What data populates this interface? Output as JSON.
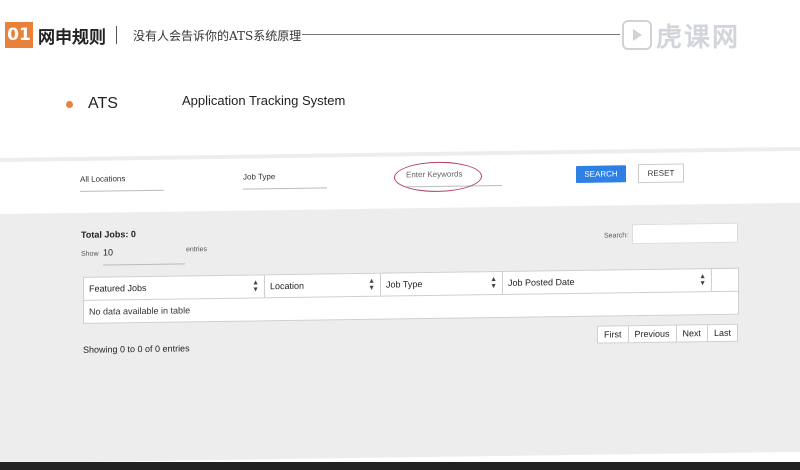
{
  "header": {
    "section_number": "01",
    "section_title": "网申规则",
    "separator": "|",
    "subtitle": "没有人会告诉你的ATS系统原理",
    "watermark_text": "虎课网",
    "accent_color": "#e8823a"
  },
  "bullet": {
    "term": "ATS",
    "description": "Application Tracking System"
  },
  "screenshot": {
    "filters": {
      "location": "All Locations",
      "job_type": "Job Type",
      "keywords_placeholder": "Enter Keywords"
    },
    "buttons": {
      "search": "SEARCH",
      "reset": "RESET",
      "search_color": "#2f80e4"
    },
    "highlight_color": "#b2456a",
    "total_jobs": "Total Jobs: 0",
    "show_label": "Show",
    "show_value": "10",
    "entries_label": "entries",
    "search_label": "Search:",
    "table": {
      "columns": [
        "Featured Jobs",
        "Location",
        "Job Type",
        "Job Posted Date"
      ],
      "empty_message": "No data available in table"
    },
    "showing_text": "Showing 0 to 0 of 0 entries",
    "pagination": [
      "First",
      "Previous",
      "Next",
      "Last"
    ]
  }
}
